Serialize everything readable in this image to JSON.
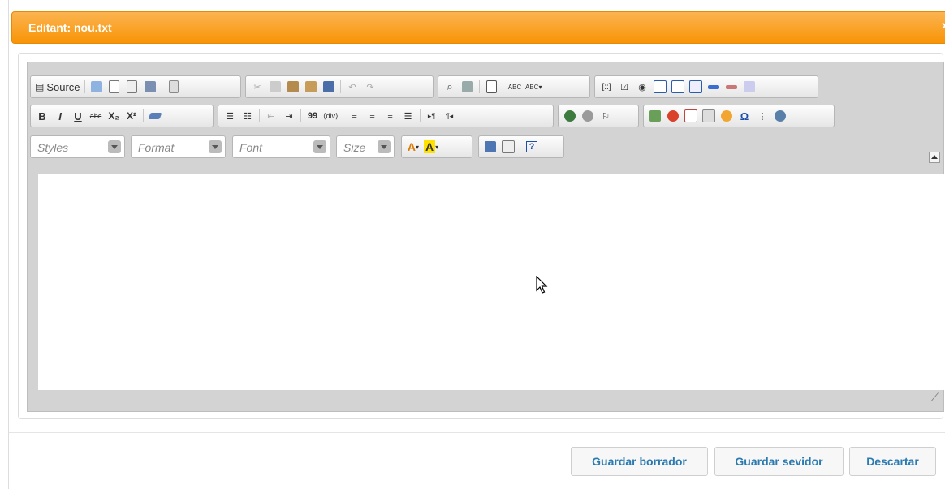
{
  "dialog": {
    "title": "Editant: nou.txt",
    "close_glyph": "×"
  },
  "toolbar": {
    "row1": [
      {
        "name": "source-button",
        "label": "Source",
        "icon": "source-icon"
      },
      {
        "name": "save-icon-button",
        "icon": "save-icon"
      },
      {
        "name": "new-page-button",
        "icon": "new-page-icon"
      },
      {
        "name": "preview-button",
        "icon": "preview-icon"
      },
      {
        "name": "print-button",
        "icon": "print-icon"
      },
      {
        "name": "templates-button",
        "icon": "templates-icon"
      },
      {
        "name": "cut-button",
        "icon": "cut-icon"
      },
      {
        "name": "copy-button",
        "icon": "copy-icon"
      },
      {
        "name": "paste-button",
        "icon": "paste-icon"
      },
      {
        "name": "paste-text-button",
        "icon": "paste-text-icon"
      },
      {
        "name": "paste-word-button",
        "icon": "paste-word-icon"
      },
      {
        "name": "undo-button",
        "icon": "undo-icon"
      },
      {
        "name": "redo-button",
        "icon": "redo-icon"
      },
      {
        "name": "find-button",
        "icon": "find-icon"
      },
      {
        "name": "replace-button",
        "icon": "replace-icon"
      },
      {
        "name": "select-all-button",
        "icon": "select-all-icon"
      },
      {
        "name": "spellcheck-button",
        "label": "ABC",
        "icon": "spellcheck-icon"
      },
      {
        "name": "scayt-button",
        "label": "ABC▾",
        "icon": "scayt-icon"
      },
      {
        "name": "form-button",
        "icon": "form-icon"
      },
      {
        "name": "checkbox-button",
        "icon": "checkbox-icon"
      },
      {
        "name": "radio-button",
        "icon": "radio-icon"
      },
      {
        "name": "textfield-button",
        "icon": "textfield-icon"
      },
      {
        "name": "textarea-button",
        "icon": "textarea-icon"
      },
      {
        "name": "select-button",
        "icon": "select-icon"
      },
      {
        "name": "button-button",
        "icon": "button-icon"
      },
      {
        "name": "image-button-button",
        "icon": "image-button-icon"
      },
      {
        "name": "hidden-field-button",
        "icon": "hidden-field-icon"
      }
    ],
    "row2_labels": {
      "bold": "B",
      "italic": "I",
      "underline": "U",
      "strike": "abc",
      "subscript": "X₂",
      "superscript": "X²",
      "blockquote": "99",
      "ltr": "▸¶",
      "rtl": "¶◂",
      "special_char": "Ω"
    },
    "row3": {
      "styles_label": "Styles",
      "format_label": "Format",
      "font_label": "Font",
      "size_label": "Size",
      "text_color_label": "A",
      "bg_color_label": "A",
      "about_label": "?"
    }
  },
  "editor": {
    "content": ""
  },
  "buttons": {
    "save_draft": "Guardar borrador",
    "save_server": "Guardar sevidor",
    "discard": "Descartar"
  },
  "colors": {
    "header": "#f89406",
    "button_text": "#2a7ab0"
  }
}
